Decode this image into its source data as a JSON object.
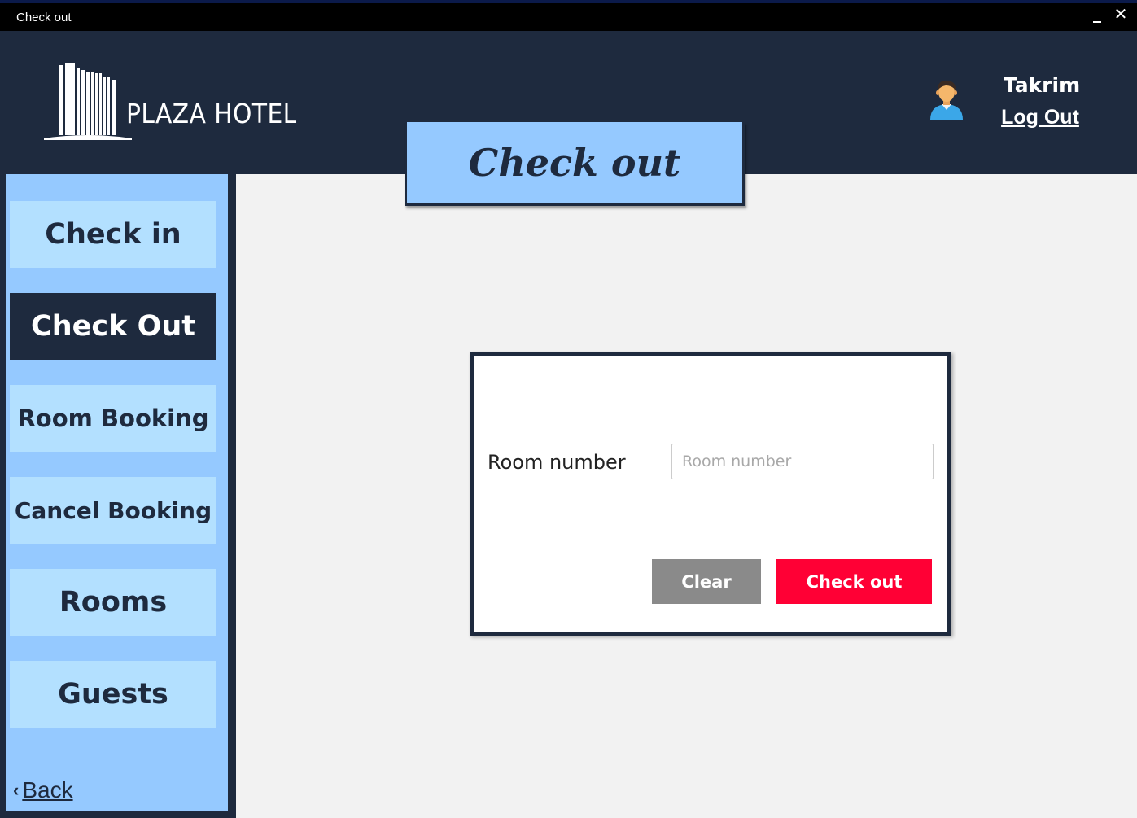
{
  "window": {
    "title": "Check out",
    "minimize_icon": "minimize-icon",
    "close_icon": "close-icon"
  },
  "header": {
    "brand": "PLAZA HOTEL",
    "logo_icon": "hotel-building-icon",
    "avatar_icon": "user-avatar-icon",
    "username": "Takrim",
    "logout_label": "Log Out"
  },
  "page": {
    "title": "Check out"
  },
  "sidebar": {
    "items": [
      {
        "label": "Check in",
        "active": false
      },
      {
        "label": "Check Out",
        "active": true
      },
      {
        "label": "Room Booking",
        "active": false
      },
      {
        "label": "Cancel Booking",
        "active": false
      },
      {
        "label": "Rooms",
        "active": false
      },
      {
        "label": "Guests",
        "active": false
      }
    ],
    "back_label": "Back"
  },
  "form": {
    "room_number_label": "Room number",
    "room_number_placeholder": "Room number",
    "room_number_value": "",
    "clear_label": "Clear",
    "checkout_label": "Check out"
  },
  "colors": {
    "header_bg": "#1e2a3e",
    "sidebar_bg": "#95c9ff",
    "nav_button_bg": "#b3e0ff",
    "clear_button": "#8a8a8a",
    "checkout_button": "#ff0035"
  }
}
